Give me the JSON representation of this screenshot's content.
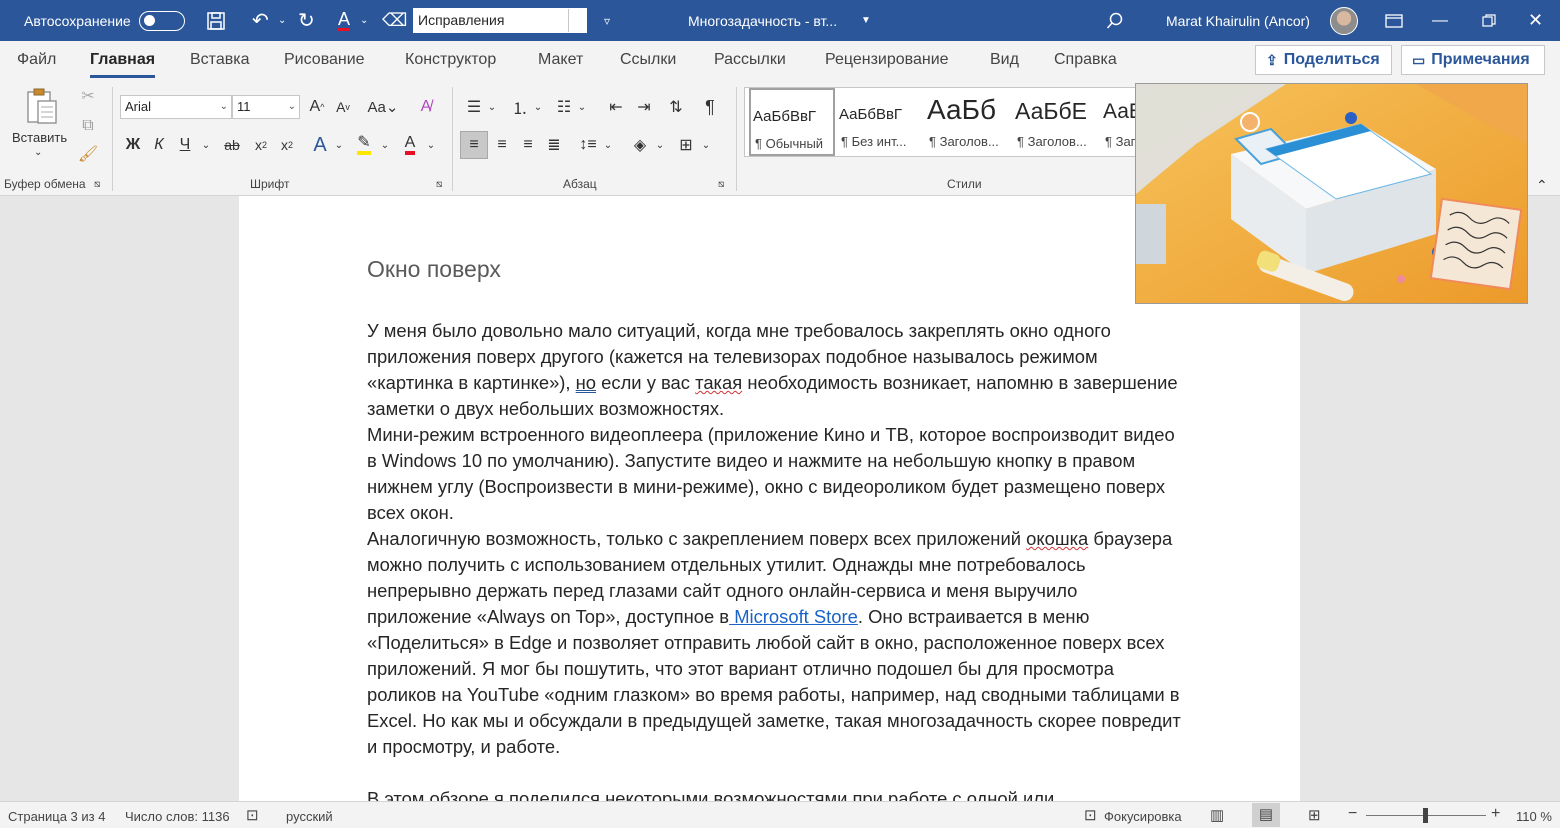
{
  "titlebar": {
    "autosave_label": "Автосохранение",
    "search_value": "Исправления",
    "doc_title": "Многозадачность - вт...",
    "user_name": "Marat Khairulin (Ancor)"
  },
  "tabs": [
    "Файл",
    "Главная",
    "Вставка",
    "Рисование",
    "Конструктор",
    "Макет",
    "Ссылки",
    "Рассылки",
    "Рецензирование",
    "Вид",
    "Справка"
  ],
  "share_label": "Поделиться",
  "comments_label": "Примечания",
  "ribbon": {
    "paste_label": "Вставить",
    "font_name": "Arial",
    "font_size": "11",
    "groups": {
      "clipboard": "Буфер обмена",
      "font": "Шрифт",
      "paragraph": "Абзац",
      "styles": "Стили"
    },
    "styles": [
      {
        "preview": "АаБбВвГ",
        "name": "¶ Обычный"
      },
      {
        "preview": "АаБбВвГ",
        "name": "¶ Без инт..."
      },
      {
        "preview": "АаБб",
        "name": "¶ Заголов..."
      },
      {
        "preview": "АаБбЕ",
        "name": "¶ Заголов..."
      },
      {
        "preview": "АаБ",
        "name": "¶ Заг"
      }
    ]
  },
  "document": {
    "heading": "Окно поверх",
    "p1_a": "У меня было довольно мало ситуаций, когда мне требовалось закреплять окно одного приложения поверх другого (кажется на телевизорах подобное называлось режимом «картинка в картинке»), ",
    "p1_b": "но",
    "p1_c": " если у вас ",
    "p1_d": "такая",
    "p1_e": " необходимость возникает, напомню в завершение заметки о двух небольших возможностях.",
    "p2": "Мини-режим встроенного видеоплеера (приложение Кино и ТВ, которое воспроизводит видео в Windows 10 по умолчанию). Запустите видео и нажмите на небольшую кнопку в правом нижнем углу (Воспроизвести в мини-режиме), окно с видеороликом будет размещено поверх всех окон.",
    "p3_a": "Аналогичную возможность, только с закреплением поверх всех приложений ",
    "p3_b": "окошка",
    "p3_c": " браузера можно получить с использованием отдельных утилит. Однажды мне потребовалось непрерывно держать перед глазами сайт одного онлайн-сервиса и меня выручило приложение «Always on Top», доступное в",
    "p3_link": " Microsoft Store",
    "p3_d": ". Оно встраивается в меню «Поделиться» в Edge и позволяет отправить любой сайт в окно, расположенное поверх всех приложений. Я мог бы пошутить, что этот вариант отлично подошел бы для просмотра роликов на YouTube «одним глазком» во время работы, например, над сводными таблицами в Excel. Но как мы и обсуждали в предыдущей заметке, такая многозадачность скорее повредит и просмотру, и работе.",
    "p4": "В этом обзоре я поделился некоторыми возможностями при работе с одной или"
  },
  "status": {
    "page": "Страница 3 из 4",
    "words": "Число слов: 1136",
    "language": "русский",
    "focus": "Фокусировка",
    "zoom": "110 %"
  },
  "colors": {
    "titlebar": "#2b579a",
    "link": "#1a62c7"
  }
}
